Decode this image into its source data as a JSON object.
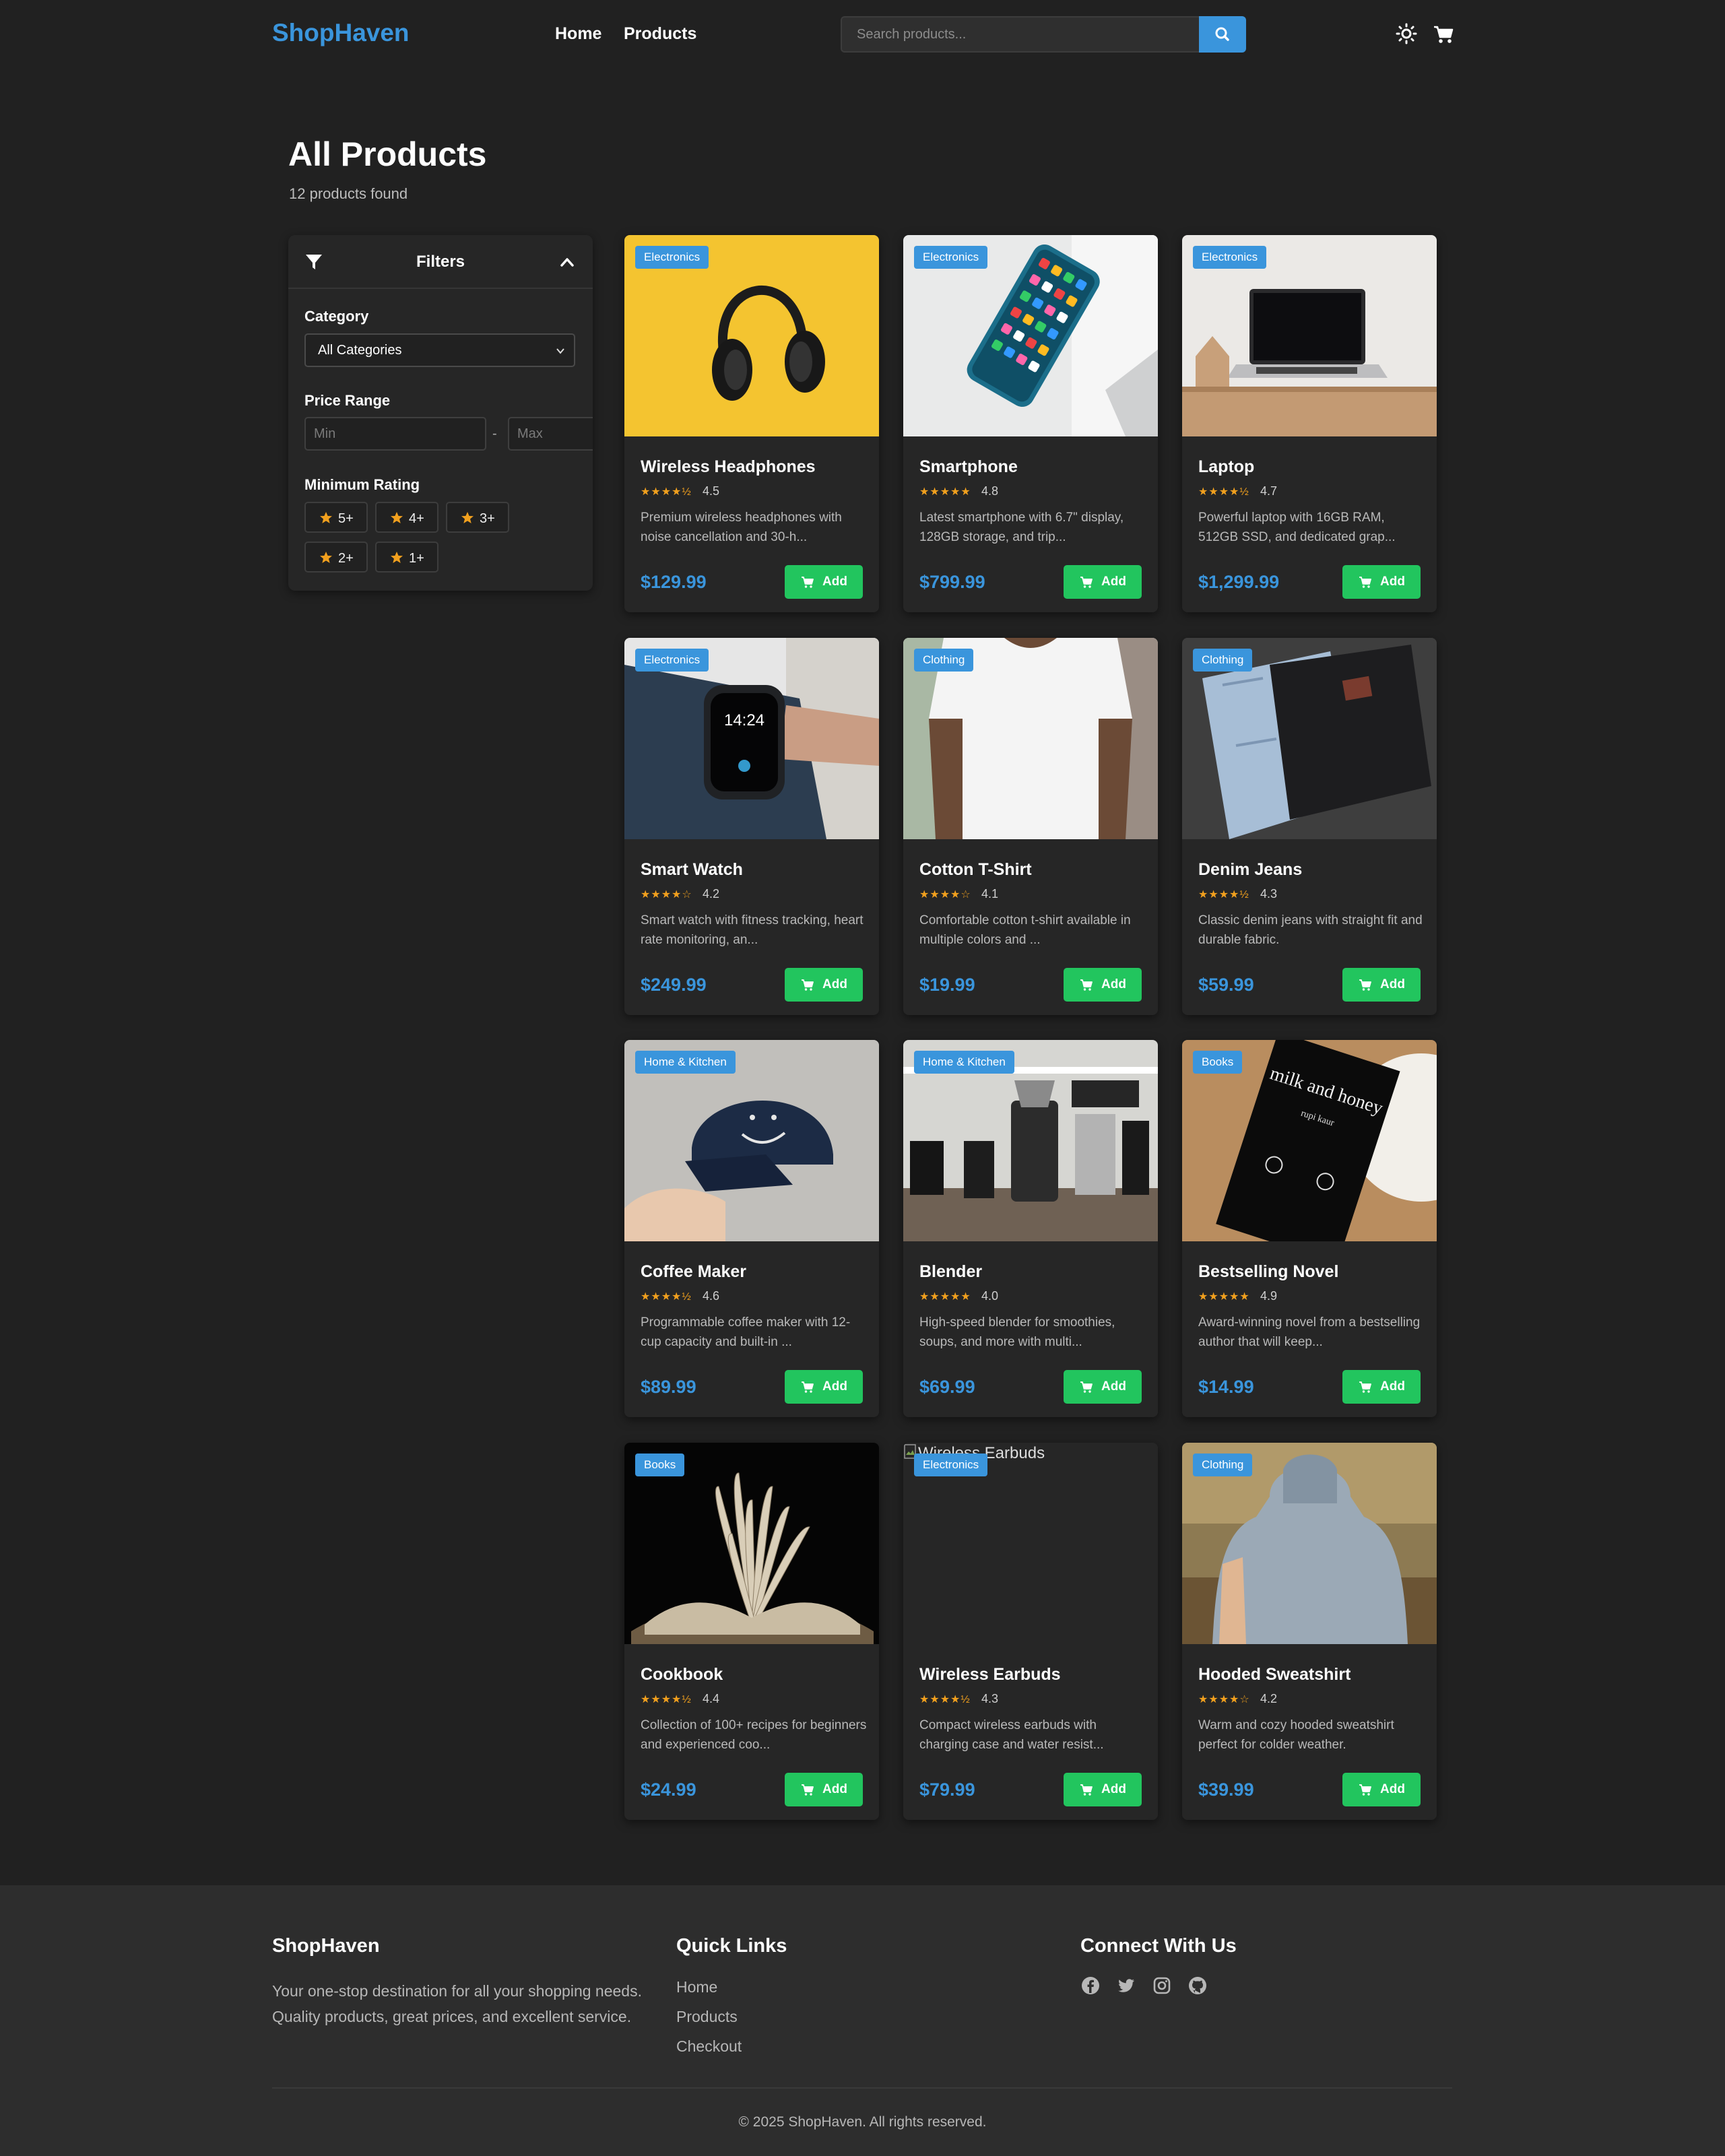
{
  "navbar": {
    "brand": "ShopHaven",
    "links": [
      "Home",
      "Products"
    ],
    "search_placeholder": "Search products..."
  },
  "header": {
    "title": "All Products",
    "count_text": "12 products found"
  },
  "filters": {
    "title": "Filters",
    "category_label": "Category",
    "category_value": "All Categories",
    "price_label": "Price Range",
    "min_placeholder": "Min",
    "max_placeholder": "Max",
    "price_separator": "-",
    "rating_label": "Minimum Rating",
    "rating_options": [
      "5+",
      "4+",
      "3+",
      "2+",
      "1+"
    ]
  },
  "colors": {
    "accent": "#3a95dc",
    "add_button": "#22c55e",
    "star": "#f1a01e",
    "background": "#212121",
    "card": "#262626"
  },
  "products": [
    {
      "name": "Wireless Headphones",
      "category": "Electronics",
      "stars": "★★★★½",
      "rating": "4.5",
      "description": "Premium wireless headphones with noise cancellation and 30-h...",
      "price": "$129.99",
      "add_label": "Add"
    },
    {
      "name": "Smartphone",
      "category": "Electronics",
      "stars": "★★★★★",
      "rating": "4.8",
      "description": "Latest smartphone with 6.7\" display, 128GB storage, and trip...",
      "price": "$799.99",
      "add_label": "Add"
    },
    {
      "name": "Laptop",
      "category": "Electronics",
      "stars": "★★★★½",
      "rating": "4.7",
      "description": "Powerful laptop with 16GB RAM, 512GB SSD, and dedicated grap...",
      "price": "$1,299.99",
      "add_label": "Add"
    },
    {
      "name": "Smart Watch",
      "category": "Electronics",
      "stars": "★★★★☆",
      "rating": "4.2",
      "description": "Smart watch with fitness tracking, heart rate monitoring, an...",
      "price": "$249.99",
      "add_label": "Add"
    },
    {
      "name": "Cotton T-Shirt",
      "category": "Clothing",
      "stars": "★★★★☆",
      "rating": "4.1",
      "description": "Comfortable cotton t-shirt available in multiple colors and ...",
      "price": "$19.99",
      "add_label": "Add"
    },
    {
      "name": "Denim Jeans",
      "category": "Clothing",
      "stars": "★★★★½",
      "rating": "4.3",
      "description": "Classic denim jeans with straight fit and durable fabric.",
      "price": "$59.99",
      "add_label": "Add"
    },
    {
      "name": "Coffee Maker",
      "category": "Home & Kitchen",
      "stars": "★★★★½",
      "rating": "4.6",
      "description": "Programmable coffee maker with 12-cup capacity and built-in ...",
      "price": "$89.99",
      "add_label": "Add"
    },
    {
      "name": "Blender",
      "category": "Home & Kitchen",
      "stars": "★★★★★",
      "rating": "4.0",
      "description": "High-speed blender for smoothies, soups, and more with multi...",
      "price": "$69.99",
      "add_label": "Add"
    },
    {
      "name": "Bestselling Novel",
      "category": "Books",
      "stars": "★★★★★",
      "rating": "4.9",
      "description": "Award-winning novel from a bestselling author that will keep...",
      "price": "$14.99",
      "add_label": "Add"
    },
    {
      "name": "Cookbook",
      "category": "Books",
      "stars": "★★★★½",
      "rating": "4.4",
      "description": "Collection of 100+ recipes for beginners and experienced coo...",
      "price": "$24.99",
      "add_label": "Add"
    },
    {
      "name": "Wireless Earbuds",
      "category": "Electronics",
      "stars": "★★★★½",
      "rating": "4.3",
      "description": "Compact wireless earbuds with charging case and water resist...",
      "price": "$79.99",
      "add_label": "Add",
      "image_alt": "Wireless Earbuds"
    },
    {
      "name": "Hooded Sweatshirt",
      "category": "Clothing",
      "stars": "★★★★☆",
      "rating": "4.2",
      "description": "Warm and cozy hooded sweatshirt perfect for colder weather.",
      "price": "$39.99",
      "add_label": "Add"
    }
  ],
  "image_labels": {
    "book_title": "milk and honey",
    "book_author": "rupi kaur",
    "watch_time": "14:24"
  },
  "footer": {
    "brand": "ShopHaven",
    "description": "Your one-stop destination for all your shopping needs. Quality products, great prices, and excellent service.",
    "quick_links_title": "Quick Links",
    "links": [
      "Home",
      "Products",
      "Checkout"
    ],
    "connect_title": "Connect With Us",
    "social_icons": [
      "facebook-icon",
      "twitter-icon",
      "instagram-icon",
      "github-icon"
    ],
    "copyright": "© 2025 ShopHaven. All rights reserved."
  }
}
